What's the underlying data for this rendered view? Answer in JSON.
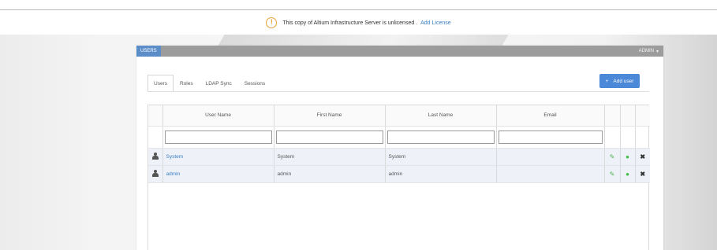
{
  "license_banner": {
    "icon": "warning-circle-icon",
    "icon_glyph": "!",
    "message": "This copy of Altium Infrastructure Server is unlicensed .",
    "link": "Add License"
  },
  "panel": {
    "section_tab": "USERS",
    "user_menu": "ADMIN",
    "user_menu_caret": "▾"
  },
  "tabs": [
    {
      "label": "Users",
      "active": true
    },
    {
      "label": "Roles",
      "active": false
    },
    {
      "label": "LDAP Sync",
      "active": false
    },
    {
      "label": "Sessions",
      "active": false
    }
  ],
  "add_user": {
    "icon": "plus-icon",
    "glyph": "+",
    "label": "Add user"
  },
  "table": {
    "columns": [
      "User Name",
      "First Name",
      "Last Name",
      "Email"
    ],
    "filters": {
      "user_name": "",
      "first_name": "",
      "last_name": "",
      "email": ""
    },
    "rows": [
      {
        "user_name": "System",
        "first_name": "System",
        "last_name": "System",
        "email": ""
      },
      {
        "user_name": "admin",
        "first_name": "admin",
        "last_name": "admin",
        "email": ""
      }
    ],
    "action_glyphs": {
      "edit": "✎",
      "status": "●",
      "delete": "✖"
    }
  },
  "colors": {
    "accent": "#4b88d8",
    "header_bar": "#9c9c9c",
    "link": "#3a7ec2",
    "warning": "#e8a23a",
    "active_status": "#3dbb45"
  }
}
